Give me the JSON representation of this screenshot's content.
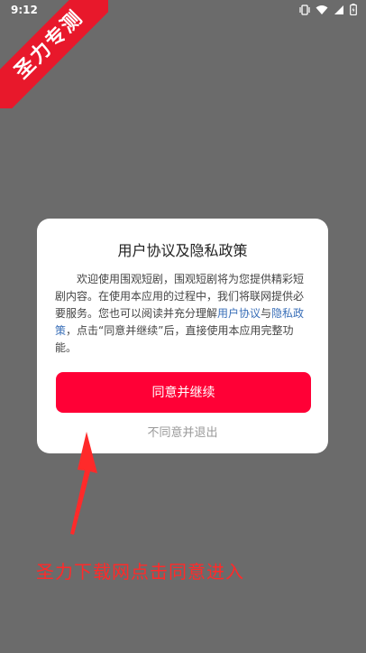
{
  "status_bar": {
    "time": "9:12",
    "icons": [
      "vibrate-icon",
      "wifi-icon",
      "signal-icon",
      "battery-icon"
    ]
  },
  "watermark": {
    "text": "圣力专测"
  },
  "dialog": {
    "title": "用户协议及隐私政策",
    "body_part1": "欢迎使用围观短剧，围观短剧将为您提供精彩短剧内容。在使用本应用的过程中，我们将联网提供必要服务。您也可以阅读并充分理解",
    "link_user_agreement": "用户协议",
    "body_part2": "与",
    "link_privacy_policy": "隐私政策",
    "body_part3": "，点击“同意并继续”后，直接使用本应用完整功能。",
    "agree_button": "同意并继续",
    "disagree_link": "不同意并退出"
  },
  "annotation": {
    "text": "圣力下载网点击同意进入"
  },
  "colors": {
    "overlay": "#6b6b6b",
    "accent": "#ff0036",
    "link": "#3a6fb8",
    "annotation": "#ff2a2a"
  }
}
